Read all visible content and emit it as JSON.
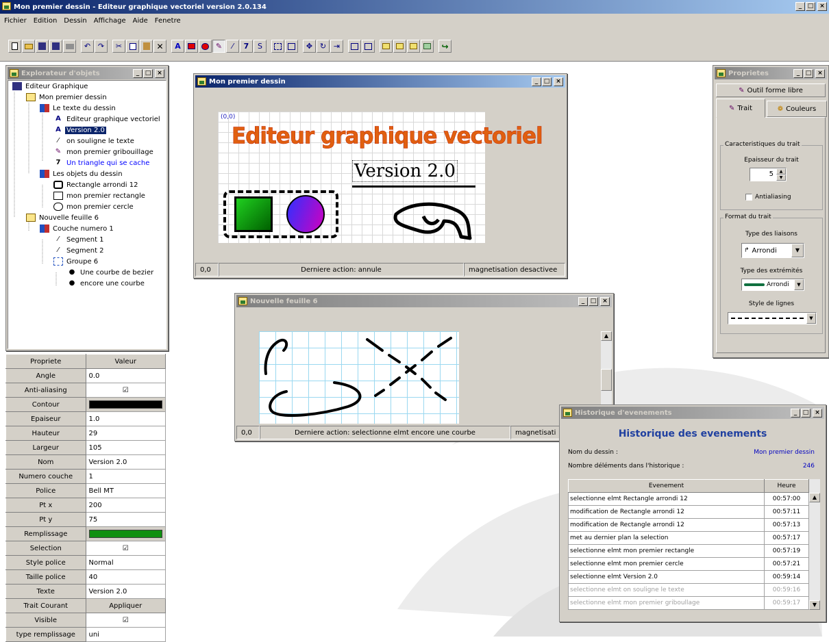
{
  "app": {
    "title": "Mon premier dessin - Editeur graphique vectoriel version 2.0.134",
    "menu": [
      "Fichier",
      "Edition",
      "Dessin",
      "Affichage",
      "Aide",
      "Fenetre"
    ]
  },
  "explorer": {
    "title": "Explorateur d'objets",
    "items": [
      {
        "label": "Editeur Graphique",
        "icon": "editor-icon"
      },
      {
        "label": "Mon premier dessin",
        "icon": "drawing-icon"
      },
      {
        "label": "Le texte du dessin",
        "icon": "layer-icon"
      },
      {
        "label": "Editeur graphique vectoriel",
        "icon": "text-icon"
      },
      {
        "label": "Version 2.0",
        "icon": "text-icon"
      },
      {
        "label": "on souligne le texte",
        "icon": "line-icon"
      },
      {
        "label": "mon premier gribouillage",
        "icon": "freehand-icon"
      },
      {
        "label": "Un triangle qui se cache",
        "icon": "polyline-icon"
      },
      {
        "label": "Les objets du dessin",
        "icon": "layer-icon"
      },
      {
        "label": "Rectangle arrondi 12",
        "icon": "rounded-rect-icon"
      },
      {
        "label": "mon premier rectangle",
        "icon": "rect-icon"
      },
      {
        "label": "mon premier cercle",
        "icon": "circle-icon"
      },
      {
        "label": "Nouvelle feuille 6",
        "icon": "drawing-icon"
      },
      {
        "label": "Couche numero 1",
        "icon": "layer-icon"
      },
      {
        "label": "Segment 1",
        "icon": "line-icon"
      },
      {
        "label": "Segment 2",
        "icon": "line-icon"
      },
      {
        "label": "Groupe 6",
        "icon": "group-icon"
      },
      {
        "label": "Une courbe de bezier",
        "icon": "bullet-icon"
      },
      {
        "label": "encore une courbe",
        "icon": "bullet-icon"
      }
    ]
  },
  "props_table": {
    "headers": [
      "Propriete",
      "Valeur"
    ],
    "rows": [
      {
        "key": "Angle",
        "value": "0.0"
      },
      {
        "key": "Anti-aliasing",
        "value": "☑"
      },
      {
        "key": "Contour",
        "value": ""
      },
      {
        "key": "Epaiseur",
        "value": "1.0"
      },
      {
        "key": "Hauteur",
        "value": "29"
      },
      {
        "key": "Largeur",
        "value": "105"
      },
      {
        "key": "Nom",
        "value": "Version 2.0"
      },
      {
        "key": "Numero couche",
        "value": "1"
      },
      {
        "key": "Police",
        "value": "Bell MT"
      },
      {
        "key": "Pt x",
        "value": "200"
      },
      {
        "key": "Pt y",
        "value": "75"
      },
      {
        "key": "Remplissage",
        "value": ""
      },
      {
        "key": "Selection",
        "value": "☑"
      },
      {
        "key": "Style police",
        "value": "Normal"
      },
      {
        "key": "Taille police",
        "value": "40"
      },
      {
        "key": "Texte",
        "value": "Version 2.0"
      },
      {
        "key": "Trait Courant",
        "value": "Appliquer"
      },
      {
        "key": "Visible",
        "value": "☑"
      },
      {
        "key": "type remplissage",
        "value": "uni"
      }
    ],
    "contour_color": "#000000",
    "fill_color": "#109010"
  },
  "drawing_window": {
    "title": "Mon premier dessin",
    "origin": "(0,0)",
    "heading": "Editeur graphique vectoriel",
    "version": "Version 2.0",
    "status": [
      "0,0",
      "Derniere action: annule",
      "magnetisation desactivee"
    ]
  },
  "sheet_window": {
    "title": "Nouvelle feuille 6",
    "status": [
      "0,0",
      "Derniere action: selectionne elmt encore une courbe",
      "magnetisati"
    ]
  },
  "properties_panel": {
    "title": "Proprietes",
    "tool": "Outil forme libre",
    "tabs": [
      "Trait",
      "Couleurs"
    ],
    "group1": "Caracteristiques du trait",
    "thickness_label": "Epaisseur du trait",
    "thickness_value": "5",
    "antialias_label": "Antialiasing",
    "group2": "Format du trait",
    "join_label": "Type des liaisons",
    "join_value": "Arrondi",
    "end_label": "Type des extrémités",
    "end_value": "Arrondi",
    "style_label": "Style de lignes"
  },
  "history": {
    "title": "Historique d'evenements",
    "heading": "Historique des evenements",
    "name_label": "Nom du dessin :",
    "name_value": "Mon premier dessin",
    "count_label": "Nombre déléments dans l'historique :",
    "count_value": "246",
    "headers": [
      "Evenement",
      "Heure"
    ],
    "rows": [
      {
        "event": "selectionne elmt Rectangle arrondi 12",
        "time": "00:57:00",
        "dim": false
      },
      {
        "event": "modification de Rectangle arrondi 12",
        "time": "00:57:11",
        "dim": false
      },
      {
        "event": "modification de Rectangle arrondi 12",
        "time": "00:57:13",
        "dim": false
      },
      {
        "event": "met au dernier plan la selection",
        "time": "00:57:17",
        "dim": false
      },
      {
        "event": "selectionne elmt mon premier rectangle",
        "time": "00:57:19",
        "dim": false
      },
      {
        "event": "selectionne elmt mon premier cercle",
        "time": "00:57:21",
        "dim": false
      },
      {
        "event": "selectionne elmt Version 2.0",
        "time": "00:59:14",
        "dim": false
      },
      {
        "event": "selectionne elmt on souligne le texte",
        "time": "00:59:16",
        "dim": true
      },
      {
        "event": "selectionne elmt mon premier griboullage",
        "time": "00:59:17",
        "dim": true
      }
    ]
  }
}
